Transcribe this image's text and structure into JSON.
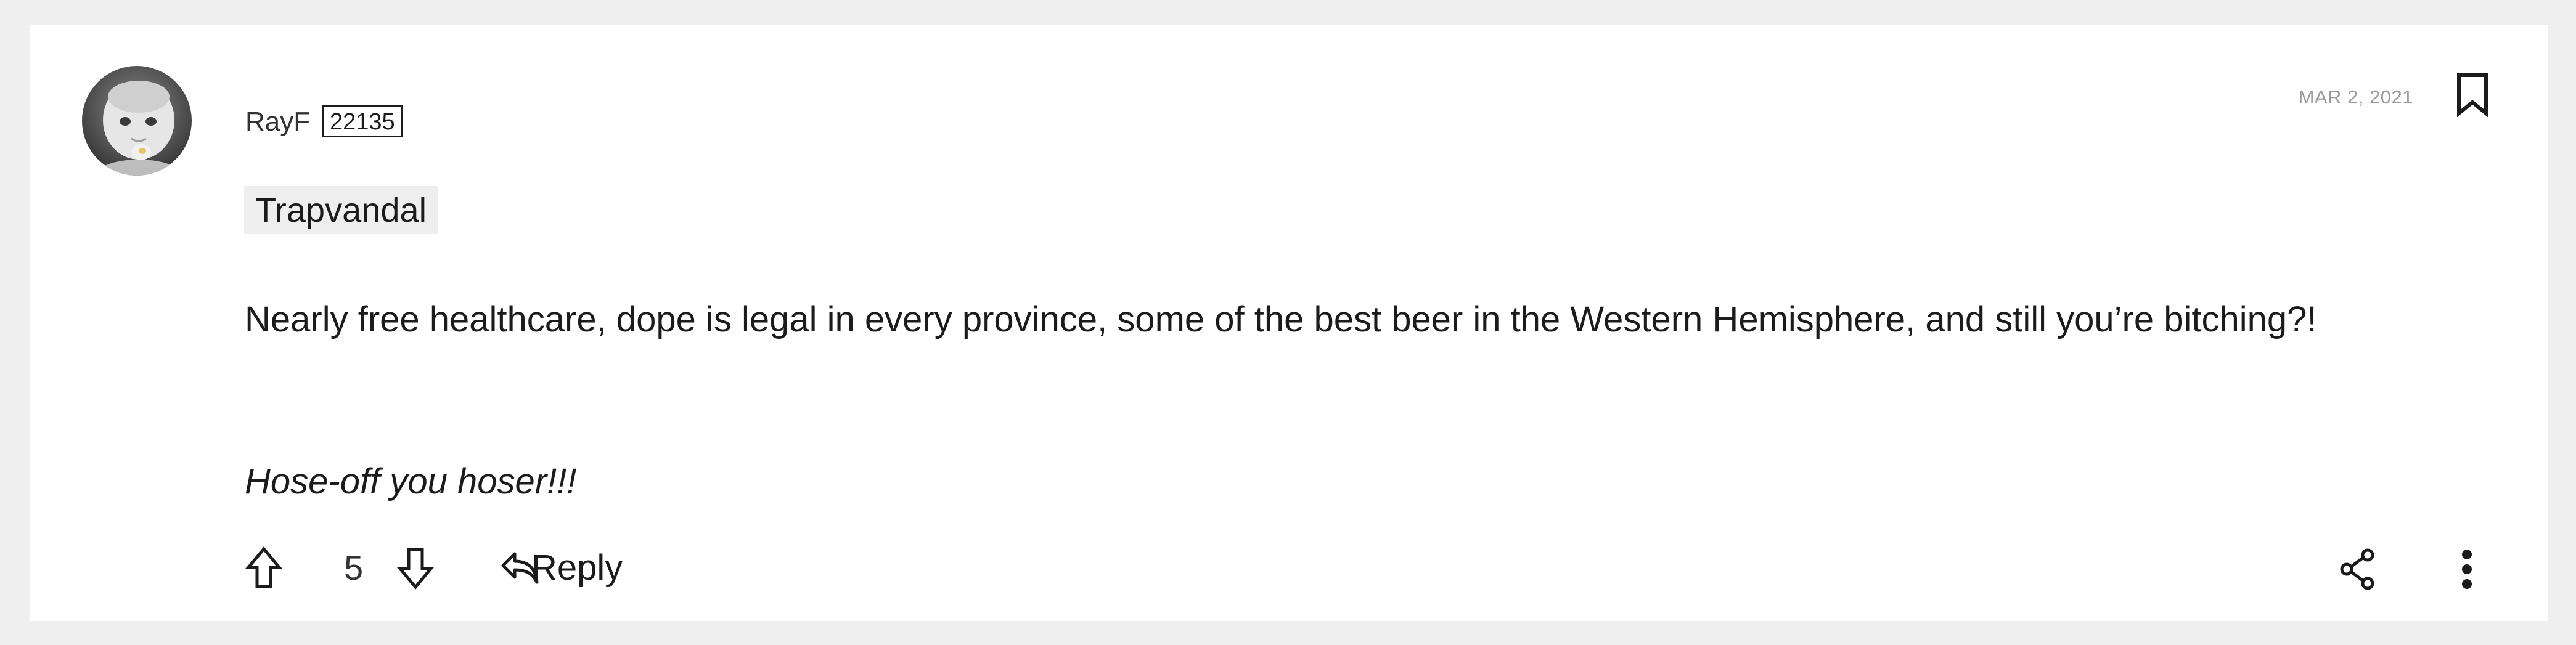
{
  "comment": {
    "author": "RayF",
    "author_badge": "22135",
    "date": "MAR 2, 2021",
    "headline": "Trapvandal",
    "body": "Nearly free healthcare, dope is legal in every province, some of the best beer in the Western Hemisphere, and still you’re bitching?!",
    "body_italic": "Hose-off you hoser!!!",
    "votes": "5",
    "reply_label": "Reply"
  },
  "icons": {
    "avatar": "avatar-photo",
    "bookmark": "bookmark-icon",
    "upvote": "arrow-up-icon",
    "downvote": "arrow-down-icon",
    "reply": "reply-icon",
    "share": "share-icon",
    "more": "more-vertical-icon"
  },
  "colors": {
    "page_background": "#efefef",
    "card_background": "#ffffff",
    "text": "#1b1b1b",
    "muted_text": "#9a9a9a",
    "headline_background": "#eeeeee"
  }
}
